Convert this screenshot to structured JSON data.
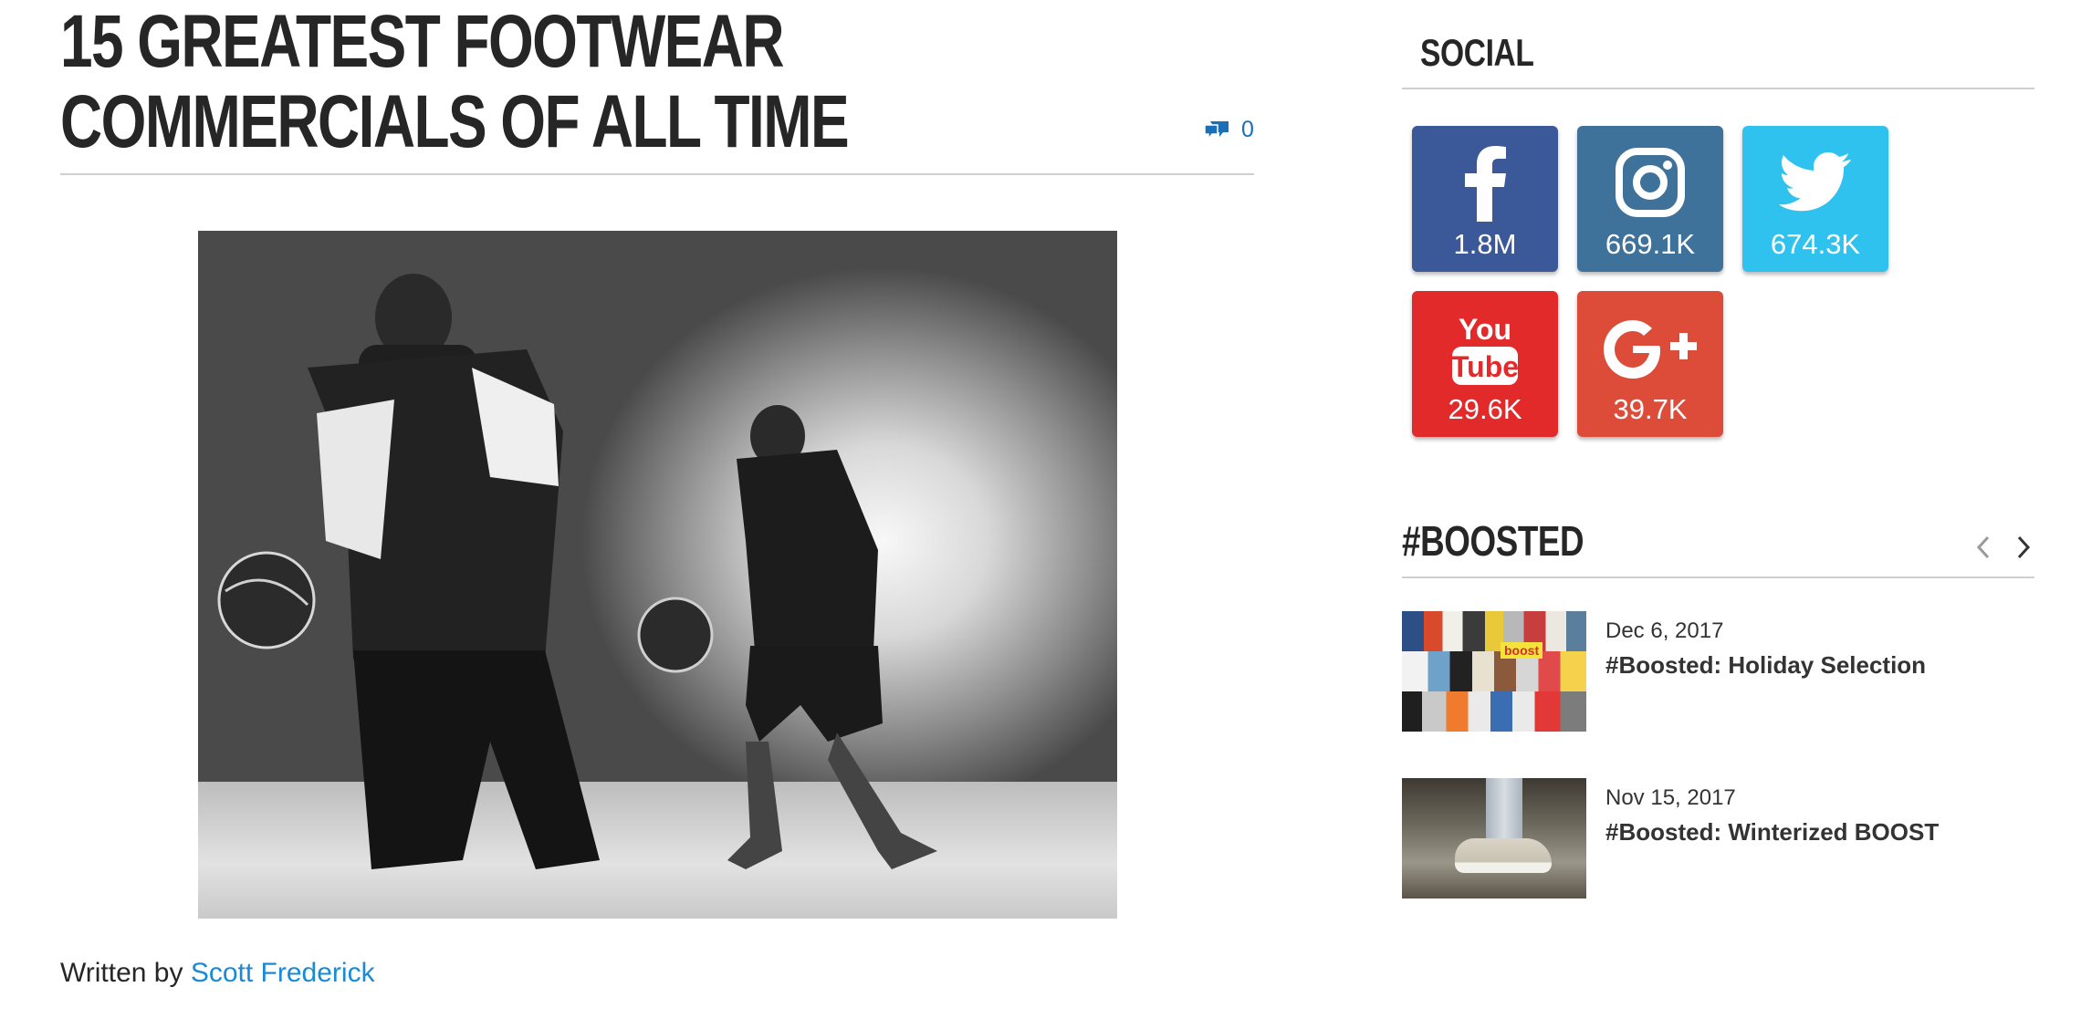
{
  "article": {
    "title": "15 Greatest Footwear Commercials of All Time",
    "comment_count": "0",
    "hero_image_alt": "",
    "byline_prefix": "Written by",
    "author": "Scott Frederick"
  },
  "sidebar": {
    "social": {
      "title": "Social",
      "tiles": [
        {
          "network": "facebook",
          "icon": "facebook-icon",
          "count": "1.8M",
          "color": "#3b5998"
        },
        {
          "network": "instagram",
          "icon": "instagram-icon",
          "count": "669.1K",
          "color": "#3f729b"
        },
        {
          "network": "twitter",
          "icon": "twitter-icon",
          "count": "674.3K",
          "color": "#2fc2ef"
        },
        {
          "network": "youtube",
          "icon": "youtube-icon",
          "count": "29.6K",
          "color": "#e32a2a",
          "logo_top": "You",
          "logo_bottom": "Tube"
        },
        {
          "network": "googleplus",
          "icon": "google-plus-icon",
          "count": "39.7K",
          "color": "#dd4b39"
        }
      ]
    },
    "boosted": {
      "title": "#Boosted",
      "posts": [
        {
          "date": "Dec 6, 2017",
          "title": "#Boosted: Holiday Selection",
          "thumb_label": "boost"
        },
        {
          "date": "Nov 15, 2017",
          "title": "#Boosted: Winterized BOOST"
        }
      ]
    }
  },
  "colors": {
    "link": "#1a8ad4",
    "comment_icon": "#1a6fb8",
    "heading": "#262626"
  }
}
